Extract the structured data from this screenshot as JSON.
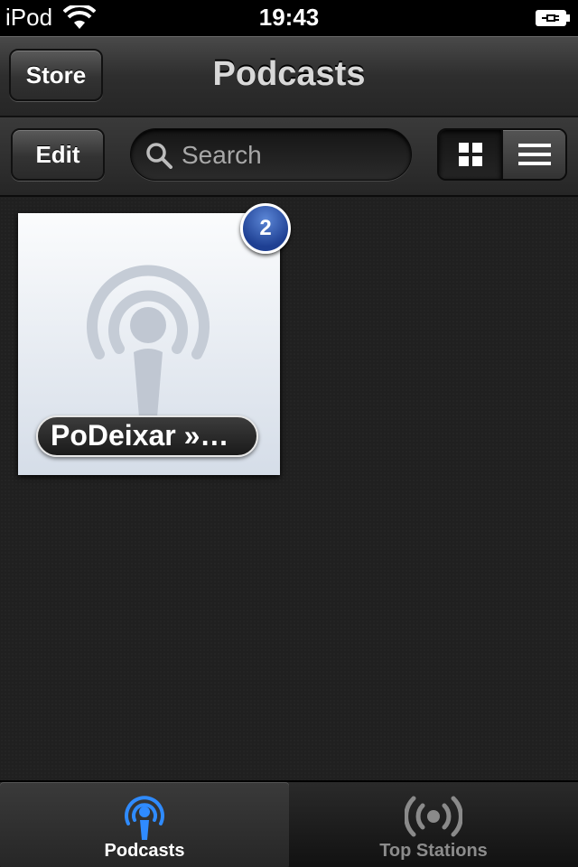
{
  "status_bar": {
    "carrier": "iPod",
    "time": "19:43"
  },
  "nav": {
    "store_label": "Store",
    "title": "Podcasts"
  },
  "toolbar": {
    "edit_label": "Edit",
    "search_placeholder": "Search"
  },
  "podcasts": [
    {
      "title": "PoDeixar »…",
      "badge": "2"
    }
  ],
  "tabs": [
    {
      "label": "Podcasts",
      "active": true
    },
    {
      "label": "Top Stations",
      "active": false
    }
  ],
  "colors": {
    "accent": "#2f8bff",
    "badge": "#1e3f92"
  }
}
